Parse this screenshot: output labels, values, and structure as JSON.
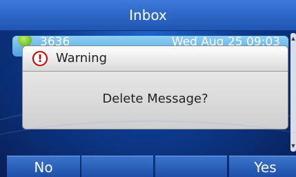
{
  "header": {
    "title": "Inbox"
  },
  "list": {
    "items": [
      {
        "number": "3636",
        "date": "Wed Aug 25 09:03"
      }
    ]
  },
  "dialog": {
    "title": "Warning",
    "message": "Delete Message?"
  },
  "softkeys": {
    "k1": "No",
    "k2": "",
    "k3": "",
    "k4": "Yes"
  },
  "icons": {
    "warning": "warning-icon",
    "message": "message-icon"
  }
}
